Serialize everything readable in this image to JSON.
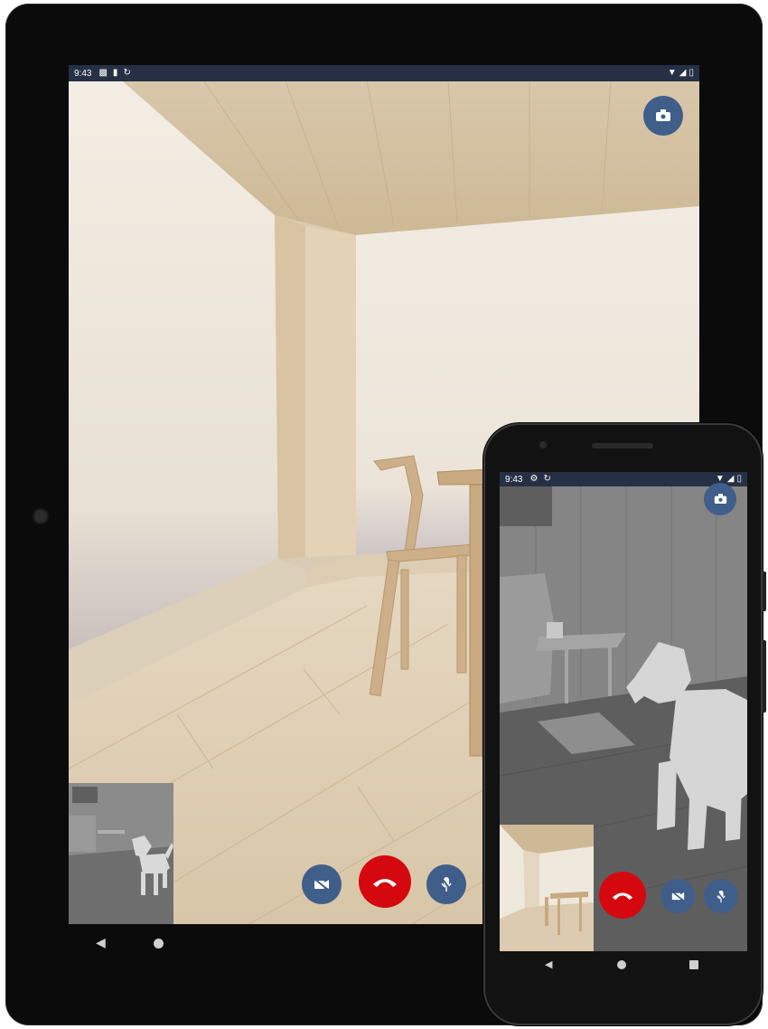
{
  "tablet": {
    "status_bar": {
      "time": "9:43",
      "left_icons": [
        "notification-a-icon",
        "sd-card-icon",
        "sync-icon"
      ],
      "right_icons": [
        "wifi-icon",
        "signal-icon",
        "battery-icon"
      ]
    },
    "controls": {
      "switch_camera_icon": "switch-camera-icon",
      "video_off_icon": "video-off-icon",
      "hang_up_icon": "hang-up-icon",
      "mute_icon": "mic-off-icon"
    },
    "nav": [
      "back",
      "home"
    ]
  },
  "phone": {
    "status_bar": {
      "time": "9:43",
      "left_icons": [
        "settings-icon",
        "sync-icon"
      ],
      "right_icons": [
        "wifi-icon",
        "signal-icon",
        "battery-icon"
      ]
    },
    "controls": {
      "switch_camera_icon": "switch-camera-icon",
      "hang_up_icon": "hang-up-icon",
      "video_off_icon": "video-off-icon",
      "mute_icon": "mic-off-icon"
    },
    "nav": [
      "back",
      "home",
      "recents"
    ]
  },
  "colors": {
    "status_bar": "#253045",
    "control_blue": "#3f5e8a",
    "hang_up_red": "#d5080f"
  }
}
